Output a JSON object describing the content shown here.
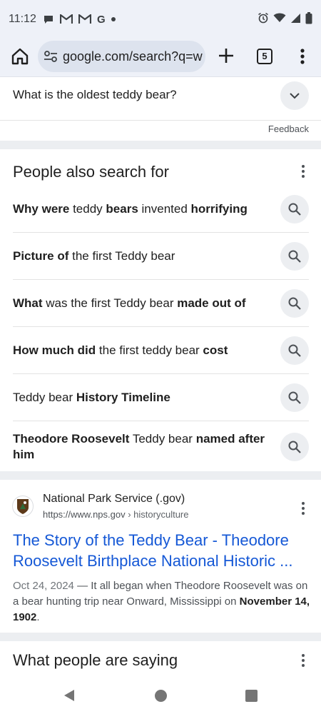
{
  "status_bar": {
    "time": "11:12",
    "left_icons": [
      "chat-icon",
      "gmail-icon",
      "gmail-icon",
      "google-icon",
      "dot-icon"
    ],
    "right_icons": [
      "alarm-icon",
      "wifi-icon",
      "signal-icon",
      "battery-icon"
    ]
  },
  "toolbar": {
    "url": "google.com/search?q=w",
    "tab_count": "5"
  },
  "faq": {
    "question": "What is the oldest teddy bear?"
  },
  "feedback_label": "Feedback",
  "people_also_search": {
    "title": "People also search for",
    "items": [
      {
        "parts": [
          [
            "b",
            "Why were"
          ],
          [
            "n",
            " teddy "
          ],
          [
            "b",
            "bears"
          ],
          [
            "n",
            " invented "
          ],
          [
            "b",
            "horrifying"
          ]
        ]
      },
      {
        "parts": [
          [
            "b",
            "Picture of"
          ],
          [
            "n",
            " the first Teddy bear"
          ]
        ]
      },
      {
        "parts": [
          [
            "b",
            "What"
          ],
          [
            "n",
            " was the first Teddy bear "
          ],
          [
            "b",
            "made out of"
          ]
        ]
      },
      {
        "parts": [
          [
            "b",
            "How much did"
          ],
          [
            "n",
            " the first teddy bear "
          ],
          [
            "b",
            "cost"
          ]
        ]
      },
      {
        "parts": [
          [
            "n",
            "Teddy bear "
          ],
          [
            "b",
            "History Timeline"
          ]
        ]
      },
      {
        "parts": [
          [
            "b",
            "Theodore Roosevelt"
          ],
          [
            "n",
            " Teddy bear "
          ],
          [
            "b",
            "named after him"
          ]
        ]
      }
    ]
  },
  "result": {
    "site_name": "National Park Service (.gov)",
    "url": "https://www.nps.gov",
    "breadcrumb": " › historyculture",
    "title": "The Story of the Teddy Bear - Theodore Roosevelt Birthplace National Historic ...",
    "date": "Oct 24, 2024",
    "snippet_before": " — It all began when Theodore Roosevelt was on a bear hunting trip near Onward, Mississippi on ",
    "snippet_bold": "November 14, 1902",
    "snippet_after": "."
  },
  "what_people_are_saying": {
    "title": "What people are saying"
  },
  "colors": {
    "link": "#1558d6",
    "chrome_bg": "#eef1f8",
    "chip_bg": "#eceef1"
  }
}
